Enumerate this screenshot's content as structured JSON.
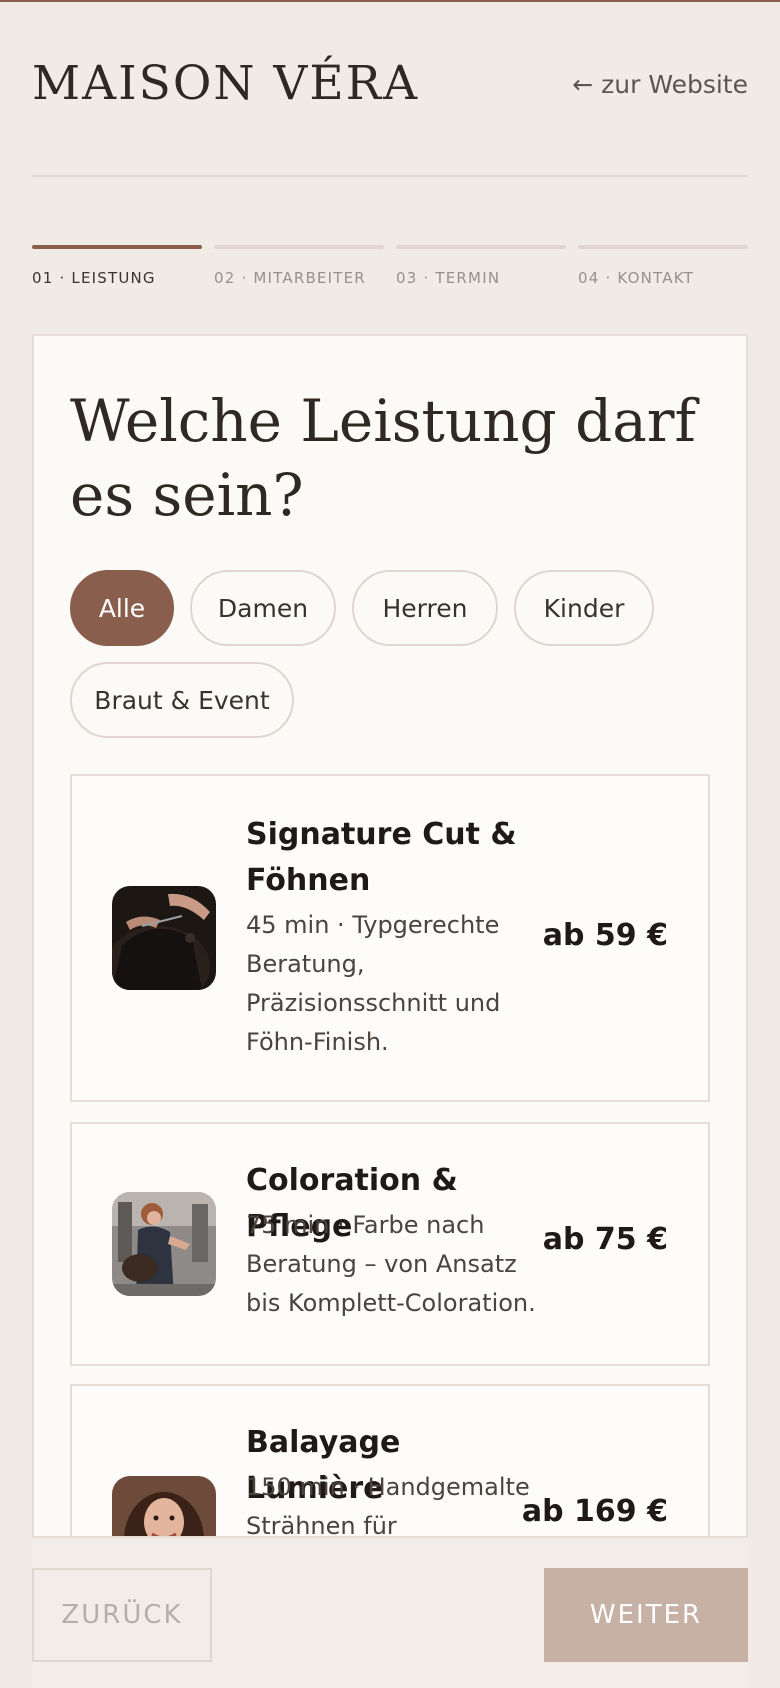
{
  "brand": "MAISON VÉRA",
  "back_link": "← zur Website",
  "steps": [
    {
      "label": "01 · LEISTUNG",
      "active": true
    },
    {
      "label": "02 · MITARBEITER",
      "active": false
    },
    {
      "label": "03 · TERMIN",
      "active": false
    },
    {
      "label": "04 · KONTAKT",
      "active": false
    }
  ],
  "heading": "Welche Leistung darf es sein?",
  "filters": [
    {
      "label": "Alle",
      "active": true
    },
    {
      "label": "Damen",
      "active": false
    },
    {
      "label": "Herren",
      "active": false
    },
    {
      "label": "Kinder",
      "active": false
    },
    {
      "label": "Braut & Event",
      "active": false
    }
  ],
  "services": [
    {
      "title": "Signature Cut & Föhnen",
      "desc": "45 min · Typgerechte Beratung, Präzisionsschnitt und Föhn-Finish.",
      "price": "ab 59 €",
      "image": "haircut-photo"
    },
    {
      "title": "Coloration & Pflege",
      "desc": "75 min · Farbe nach Beratung – von Ansatz bis Komplett-Coloration.",
      "price": "ab 75 €",
      "image": "salon-photo"
    },
    {
      "title": "Balayage Lumière",
      "desc": "150 min · Handgemalte Strähnen für",
      "price": "ab 169 €",
      "image": "portrait-photo"
    }
  ],
  "footer": {
    "back": "ZURÜCK",
    "next": "WEITER"
  },
  "colors": {
    "accent": "#8a5e4c",
    "next_button": "#c7b0a4",
    "background": "#f1ebe6"
  }
}
